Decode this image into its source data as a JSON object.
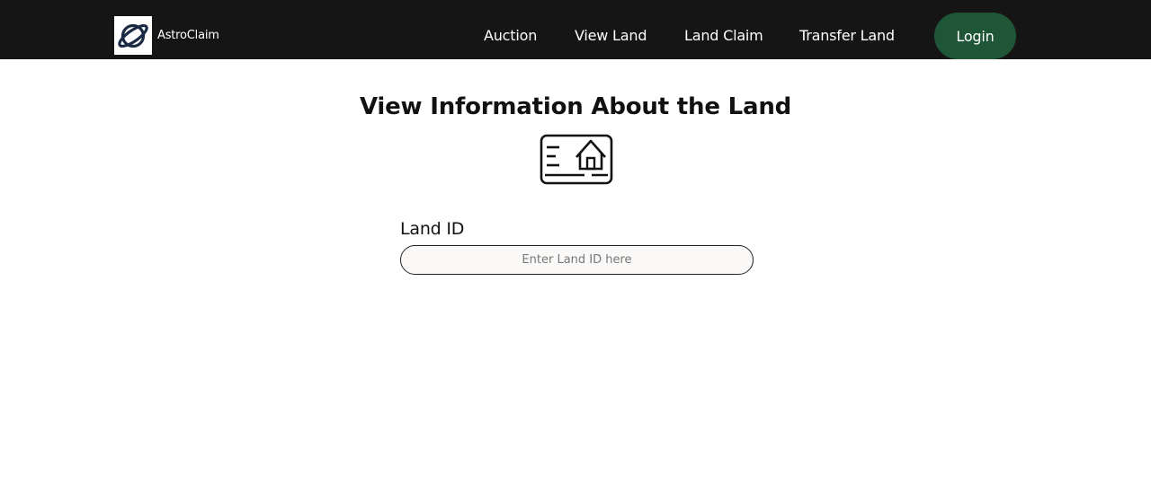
{
  "navbar": {
    "brand_name": "AstroClaim",
    "logo_icon": "planet-icon",
    "links": [
      {
        "label": "Auction"
      },
      {
        "label": "View Land"
      },
      {
        "label": "Land Claim"
      },
      {
        "label": "Transfer Land"
      }
    ],
    "login_label": "Login",
    "colors": {
      "background": "#151515",
      "login_button": "#1f5637"
    }
  },
  "main": {
    "title": "View Information About the Land",
    "illustration_icon": "land-card-icon",
    "land_id": {
      "label": "Land ID",
      "value": "",
      "placeholder": "Enter Land ID here"
    }
  }
}
